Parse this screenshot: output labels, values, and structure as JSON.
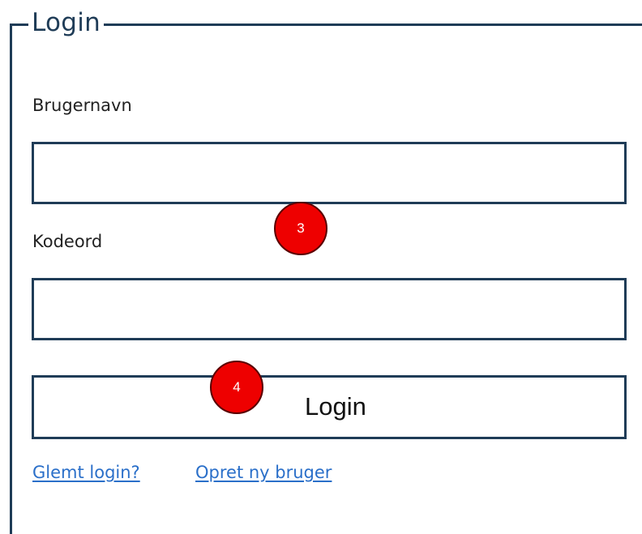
{
  "login_form": {
    "legend": "Login",
    "username_label": "Brugernavn",
    "username_value": "",
    "password_label": "Kodeord",
    "password_value": "",
    "login_button_label": "Login",
    "forgot_login_link": "Glemt login?",
    "create_user_link": "Opret ny bruger"
  },
  "annotations": {
    "marker_3": "3",
    "marker_4": "4"
  },
  "colors": {
    "border": "#1f3c57",
    "link": "#2a6fc9",
    "marker_fill": "#ee0000"
  }
}
